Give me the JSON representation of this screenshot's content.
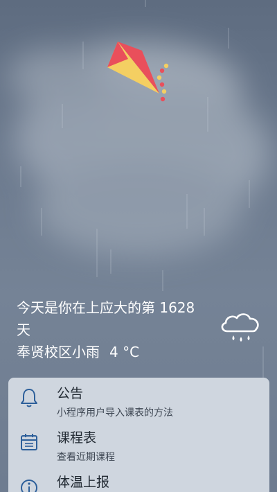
{
  "greeting": {
    "prefix": "今天是你在上应大的第",
    "days": "1628",
    "suffix": "天"
  },
  "weather": {
    "campus_condition": "奉贤校区小雨",
    "temperature": "4 °C",
    "icon": "cloud-rain-icon"
  },
  "menu": {
    "items": [
      {
        "title": "公告",
        "subtitle": "小程序用户导入课表的方法",
        "icon": "bell-icon"
      },
      {
        "title": "课程表",
        "subtitle": "查看近期课程",
        "icon": "calendar-icon"
      },
      {
        "title": "体温上报",
        "subtitle": "",
        "icon": "info-icon"
      }
    ]
  },
  "colors": {
    "kite_red": "#e94f5b",
    "kite_yellow": "#f4cf62",
    "card_bg": "#cfd6df",
    "icon_blue": "#2d5f9a"
  }
}
